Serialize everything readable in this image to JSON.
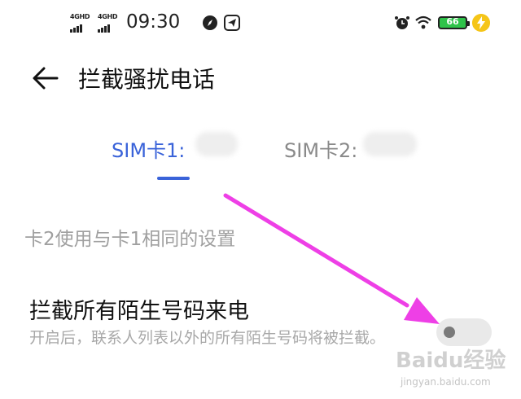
{
  "status_bar": {
    "signal1_label": "4GHD",
    "signal2_label": "4GHD",
    "time": "09:30",
    "battery_level": "66",
    "icons": [
      "signal-icon",
      "signal-icon",
      "compass-icon",
      "telegram-icon",
      "alarm-icon",
      "wifi-icon",
      "battery-icon",
      "charging-icon"
    ]
  },
  "header": {
    "title": "拦截骚扰电话"
  },
  "tabs": [
    {
      "label": "SIM卡1:",
      "selected": true
    },
    {
      "label": "SIM卡2:",
      "selected": false
    }
  ],
  "settings": {
    "note": "卡2使用与卡1相同的设置",
    "block_all_unknown": {
      "title": "拦截所有陌生号码来电",
      "description": "开启后，联系人列表以外的所有陌生号码将被拦截。",
      "enabled": false
    }
  },
  "watermark": {
    "main": "Baidu经验",
    "sub": "jingyan.baidu.com"
  },
  "colors": {
    "accent": "#3a63d9",
    "annotation_arrow": "#ee3fe6",
    "battery": "#2fc34a"
  }
}
